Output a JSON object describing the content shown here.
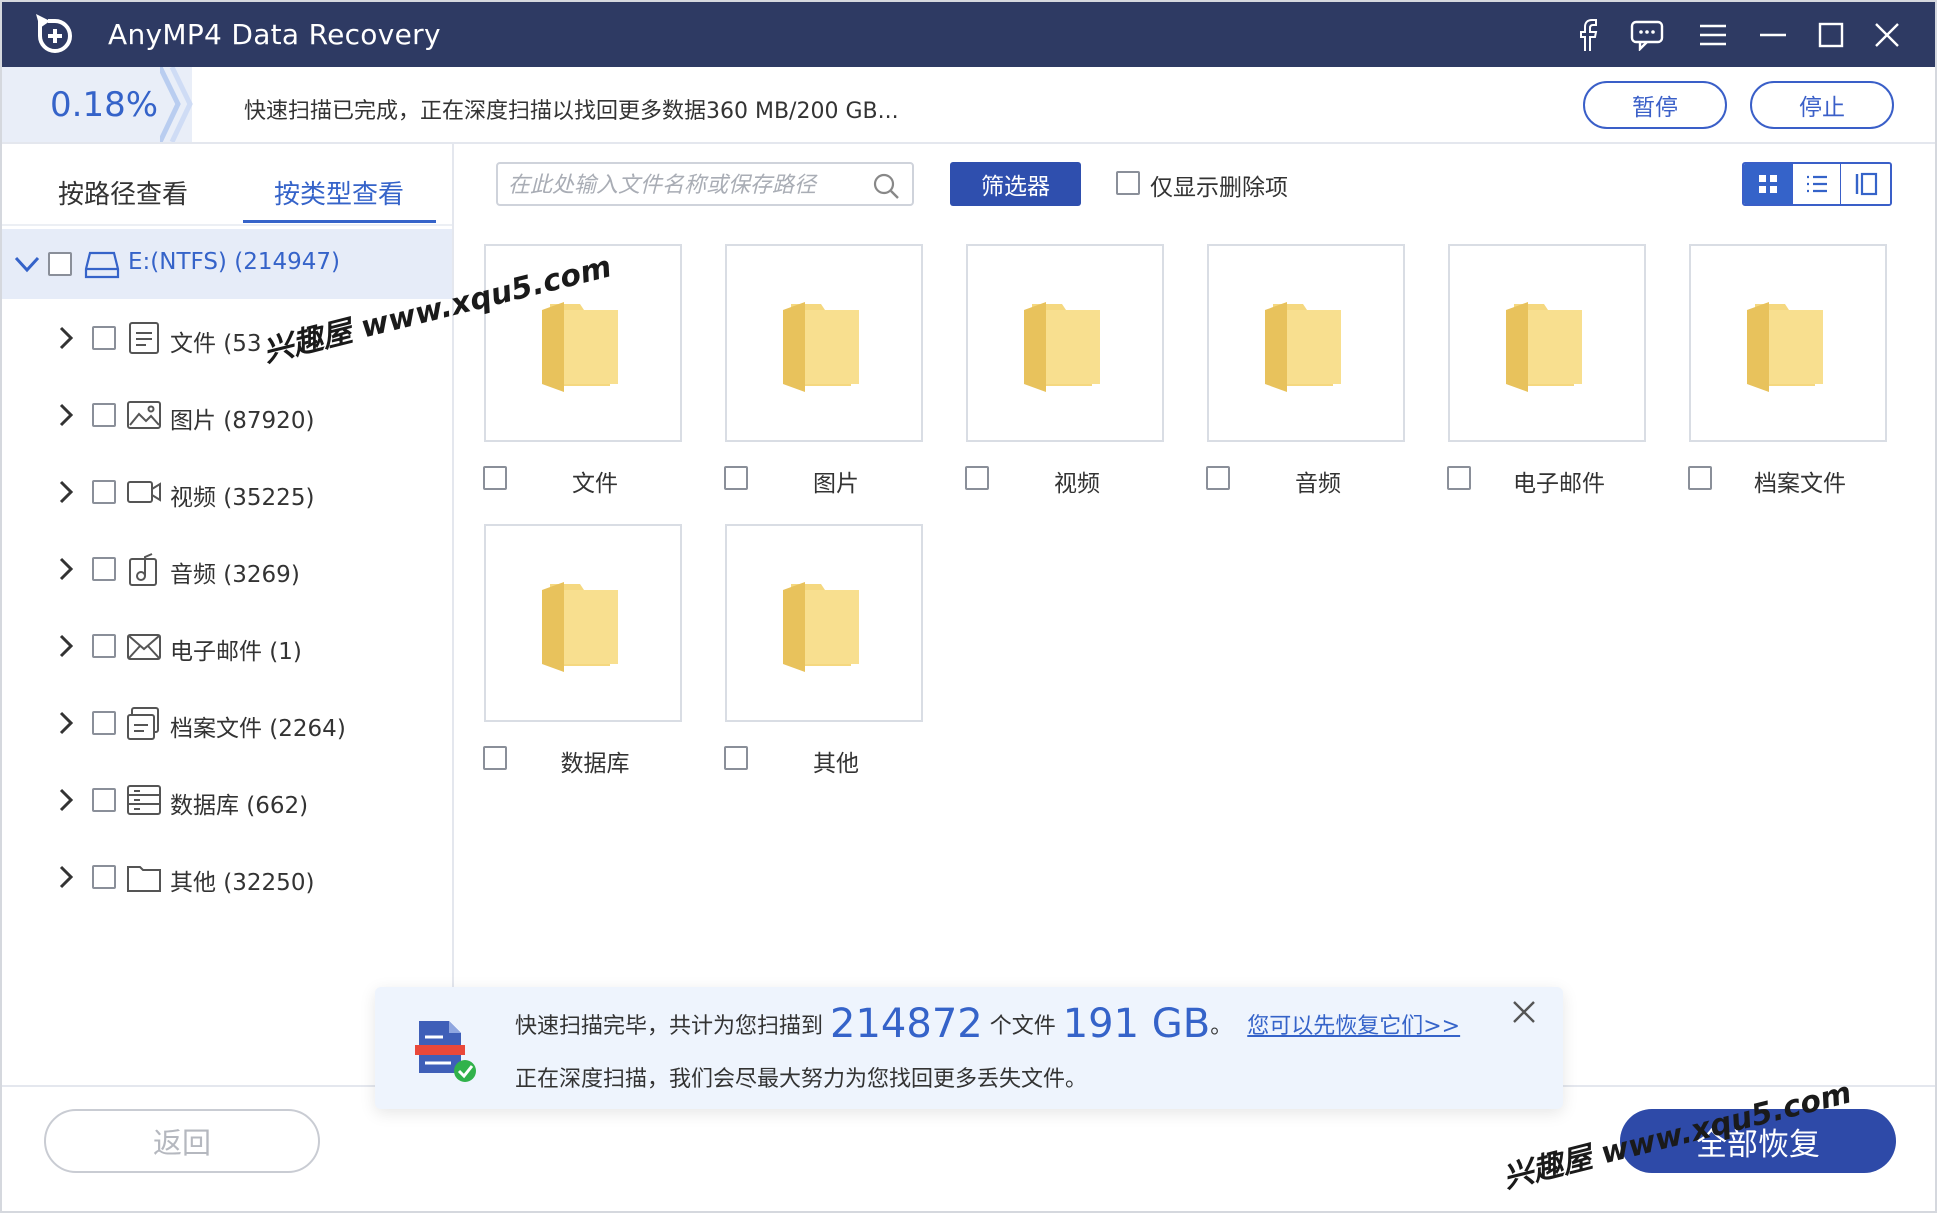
{
  "window": {
    "title": "AnyMP4 Data Recovery",
    "accent_color": "#2e3a63",
    "title_icons": [
      "facebook-icon",
      "feedback-icon",
      "menu-icon",
      "minimize-icon",
      "maximize-icon",
      "close-icon"
    ]
  },
  "scan": {
    "percent": "0.18%",
    "status": "快速扫描已完成，正在深度扫描以找回更多数据360 MB/200 GB...",
    "pause_label": "暂停",
    "stop_label": "停止"
  },
  "sidebar": {
    "tabs": [
      "按路径查看",
      "按类型查看"
    ],
    "active_tab": "按类型查看",
    "drive": {
      "label": "E:(NTFS) (214947)"
    },
    "items": [
      {
        "label": "文件 (53",
        "icon": "document-icon"
      },
      {
        "label": "图片 (87920)",
        "icon": "image-icon"
      },
      {
        "label": "视频 (35225)",
        "icon": "video-icon"
      },
      {
        "label": "音频 (3269)",
        "icon": "audio-icon"
      },
      {
        "label": "电子邮件 (1)",
        "icon": "email-icon"
      },
      {
        "label": "档案文件 (2264)",
        "icon": "archive-icon"
      },
      {
        "label": "数据库 (662)",
        "icon": "database-icon"
      },
      {
        "label": "其他 (32250)",
        "icon": "folder-icon"
      }
    ]
  },
  "toolbar": {
    "search_placeholder": "在此处输入文件名称或保存路径",
    "filter_label": "筛选器",
    "deleted_only_label": "仅显示删除项",
    "views": [
      "grid-view-icon",
      "list-view-icon",
      "detail-view-icon"
    ],
    "active_view": "grid-view-icon"
  },
  "folders": [
    {
      "label": "文件"
    },
    {
      "label": "图片"
    },
    {
      "label": "视频"
    },
    {
      "label": "音频"
    },
    {
      "label": "电子邮件"
    },
    {
      "label": "档案文件"
    },
    {
      "label": "数据库"
    },
    {
      "label": "其他"
    }
  ],
  "notice": {
    "text1": "快速扫描完毕，共计为您扫描到",
    "count": "214872",
    "text2": "个文件",
    "size": "191 GB",
    "text3": "。",
    "link": "您可以先恢复它们>>",
    "line2": "正在深度扫描，我们会尽最大努力为您找回更多丢失文件。"
  },
  "footer": {
    "back_label": "返回",
    "recover_all_label": "全部恢复"
  },
  "watermarks": [
    "兴趣屋 www.xqu5.com",
    "兴趣屋 www.xqu5.com"
  ],
  "colors": {
    "primary": "#3563c9",
    "button_dark": "#2e4aa8",
    "folder_yellow": "#f2cf6b"
  }
}
